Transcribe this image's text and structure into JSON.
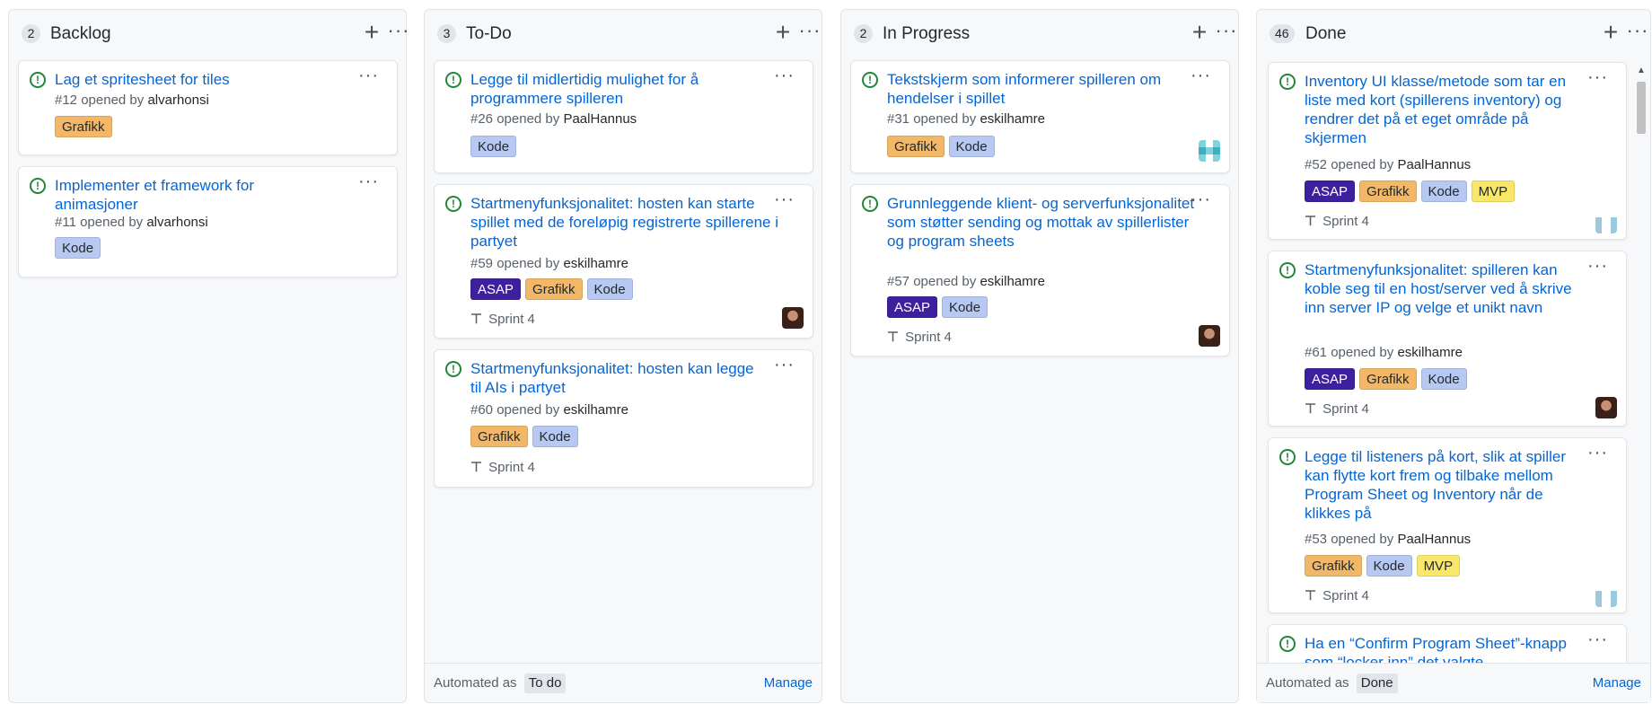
{
  "columns": [
    {
      "count": "2",
      "title": "Backlog",
      "cards": [
        {
          "title": "Lag et spritesheet for tiles",
          "number": "#12",
          "opened_by": "opened by",
          "user": "alvarhonsi",
          "labels": [
            "Grafikk"
          ]
        },
        {
          "title": "Implementer et framework for animasjoner",
          "number": "#11",
          "opened_by": "opened by",
          "user": "alvarhonsi",
          "labels": [
            "Kode"
          ]
        }
      ]
    },
    {
      "count": "3",
      "title": "To-Do",
      "cards": [
        {
          "title": "Legge til midlertidig mulighet for å programmere spilleren",
          "number": "#26",
          "opened_by": "opened by",
          "user": "PaalHannus",
          "labels": [
            "Kode"
          ]
        },
        {
          "title": "Startmenyfunksjonalitet: hosten kan starte spillet med de foreløpig registrerte spillerene i partyet",
          "number": "#59",
          "opened_by": "opened by",
          "user": "eskilhamre",
          "labels": [
            "ASAP",
            "Grafikk",
            "Kode"
          ],
          "milestone": "Sprint 4"
        },
        {
          "title": "Startmenyfunksjonalitet: hosten kan legge til AIs i partyet",
          "number": "#60",
          "opened_by": "opened by",
          "user": "eskilhamre",
          "labels": [
            "Grafikk",
            "Kode"
          ],
          "milestone": "Sprint 4"
        }
      ],
      "footer": {
        "automated": "Automated as",
        "tag": "To do",
        "manage": "Manage"
      }
    },
    {
      "count": "2",
      "title": "In Progress",
      "cards": [
        {
          "title": "Tekstskjerm som informerer spilleren om hendelser i spillet",
          "number": "#31",
          "opened_by": "opened by",
          "user": "eskilhamre",
          "labels": [
            "Grafikk",
            "Kode"
          ]
        },
        {
          "title": "Grunnleggende klient- og serverfunksjonalitet som støtter sending og mottak av spillerlister og program sheets",
          "number": "#57",
          "opened_by": "opened by",
          "user": "eskilhamre",
          "labels": [
            "ASAP",
            "Kode"
          ],
          "milestone": "Sprint 4"
        }
      ]
    },
    {
      "count": "46",
      "title": "Done",
      "cards": [
        {
          "title": "Inventory UI klasse/metode som tar en liste med kort (spillerens inventory) og rendrer det på et eget område på skjermen",
          "number": "#52",
          "opened_by": "opened by",
          "user": "PaalHannus",
          "labels": [
            "ASAP",
            "Grafikk",
            "Kode",
            "MVP"
          ],
          "milestone": "Sprint 4"
        },
        {
          "title": "Startmenyfunksjonalitet: spilleren kan koble seg til en host/server ved å skrive inn server IP og velge et unikt navn",
          "number": "#61",
          "opened_by": "opened by",
          "user": "eskilhamre",
          "labels": [
            "ASAP",
            "Grafikk",
            "Kode"
          ],
          "milestone": "Sprint 4"
        },
        {
          "title": "Legge til listeners på kort, slik at spiller kan flytte kort frem og tilbake mellom Program Sheet og Inventory når de klikkes på",
          "number": "#53",
          "opened_by": "opened by",
          "user": "PaalHannus",
          "labels": [
            "Grafikk",
            "Kode",
            "MVP"
          ],
          "milestone": "Sprint 4"
        },
        {
          "title": "Ha en “Confirm Program Sheet”-knapp som “locker inn” det valgte"
        }
      ],
      "footer": {
        "automated": "Automated as",
        "tag": "Done",
        "manage": "Manage"
      }
    }
  ],
  "icons": {
    "add": "plus-icon",
    "menu": "kebab-menu-icon",
    "issue": "issue-opened-icon",
    "milestone": "milestone-icon"
  },
  "colors": {
    "ASAP": "#3e1f9e",
    "Grafikk": "#f2b867",
    "Kode": "#b7c8f2",
    "MVP": "#f8e76a",
    "link": "#0366d6",
    "issue_open": "#22863a"
  }
}
